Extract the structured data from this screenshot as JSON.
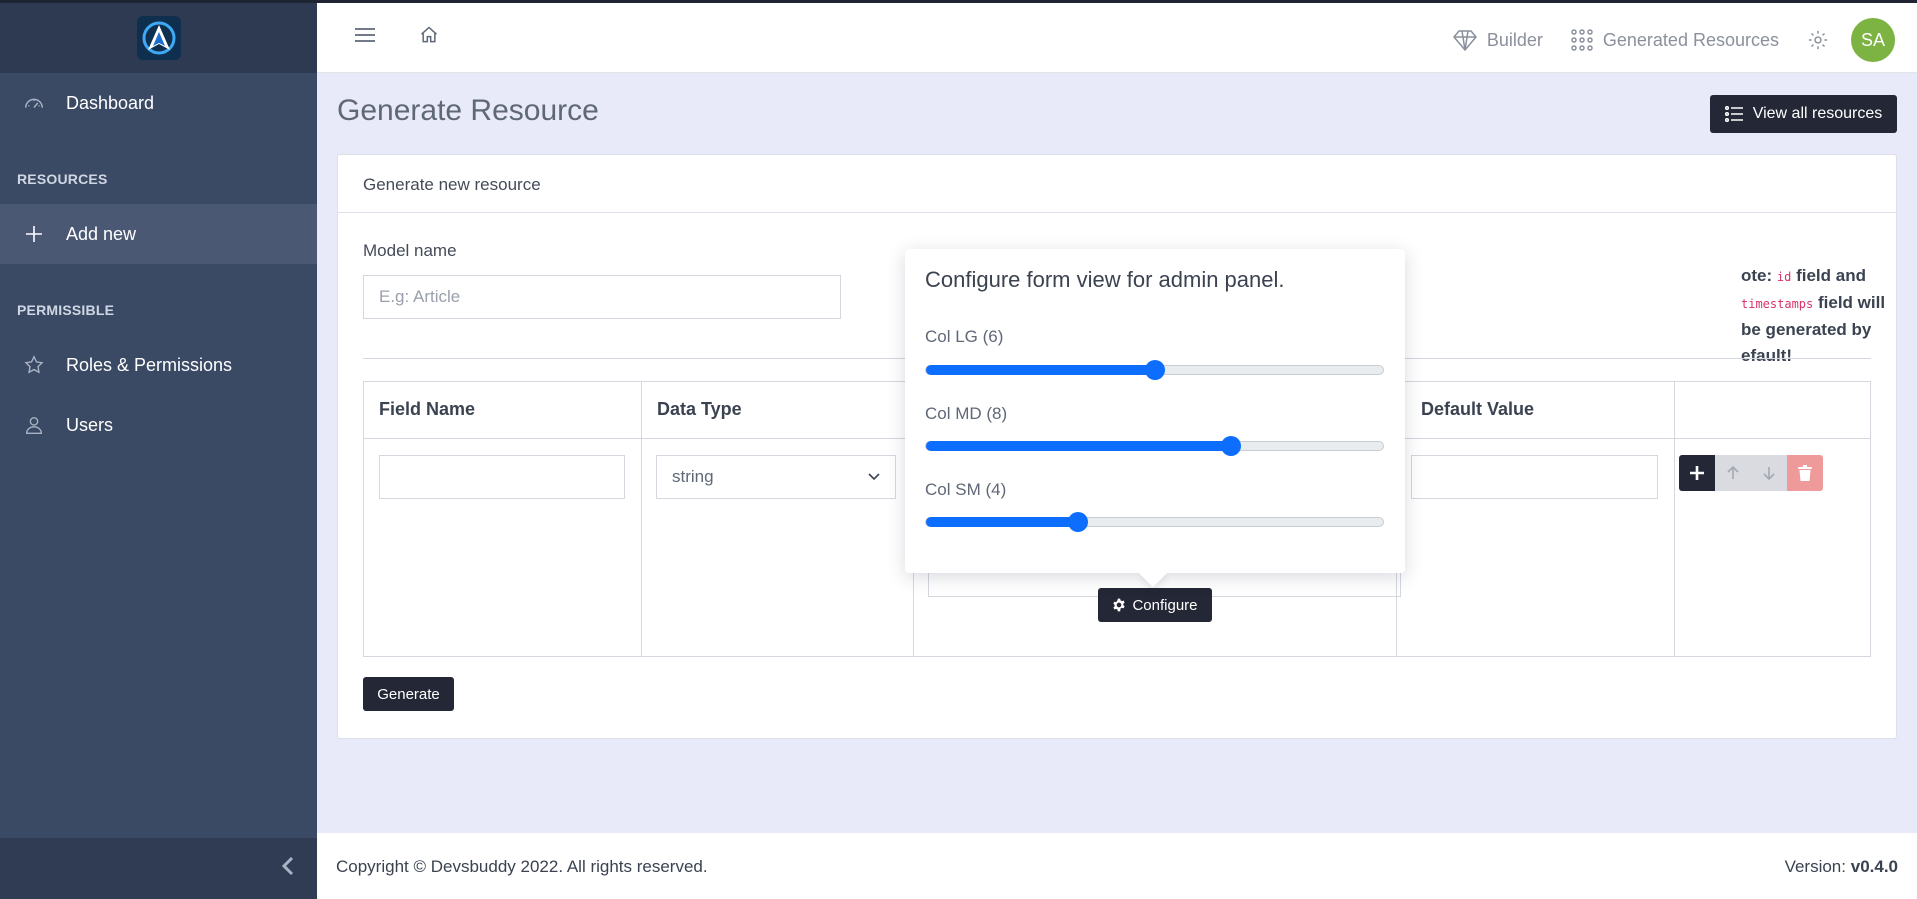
{
  "sidebar": {
    "items": [
      {
        "label": "Dashboard",
        "icon": "dashboard-icon"
      },
      {
        "label": "Add new",
        "icon": "plus-icon"
      },
      {
        "label": "Roles & Permissions",
        "icon": "star-icon"
      },
      {
        "label": "Users",
        "icon": "user-icon"
      }
    ],
    "sections": [
      "RESOURCES",
      "PERMISSIBLE"
    ]
  },
  "topbar": {
    "builder_label": "Builder",
    "generated_label": "Generated Resources",
    "avatar_initials": "SA"
  },
  "page": {
    "title": "Generate Resource",
    "view_all_label": "View all resources"
  },
  "card": {
    "header": "Generate new resource",
    "model_name_label": "Model name",
    "model_name_placeholder": "E.g: Article",
    "note_prefix": "ote:",
    "note_id": "id",
    "note_mid": "field and",
    "note_ts": "timestamps",
    "note_suffix": "field will be generated by",
    "note_line2": "efault!",
    "table": {
      "headers": [
        "Field Name",
        "Data Type",
        "Default Value"
      ],
      "data_type_value": "string"
    },
    "configure_label": "Configure",
    "generate_label": "Generate"
  },
  "popover": {
    "title": "Configure form view for admin panel.",
    "sliders": [
      {
        "label": "Col LG (6)",
        "value": 6,
        "max": 12
      },
      {
        "label": "Col MD (8)",
        "value": 8,
        "max": 12
      },
      {
        "label": "Col SM (4)",
        "value": 4,
        "max": 12
      }
    ]
  },
  "footer": {
    "copyright": "Copyright © Devsbuddy 2022. All rights reserved.",
    "version_label": "Version:",
    "version_value": "v0.4.0"
  },
  "colors": {
    "sidebar": "#3b4a64",
    "accent": "#0d6efd",
    "dark_button": "#242736",
    "avatar": "#7cb342",
    "danger_light": "#ef9a9a"
  }
}
